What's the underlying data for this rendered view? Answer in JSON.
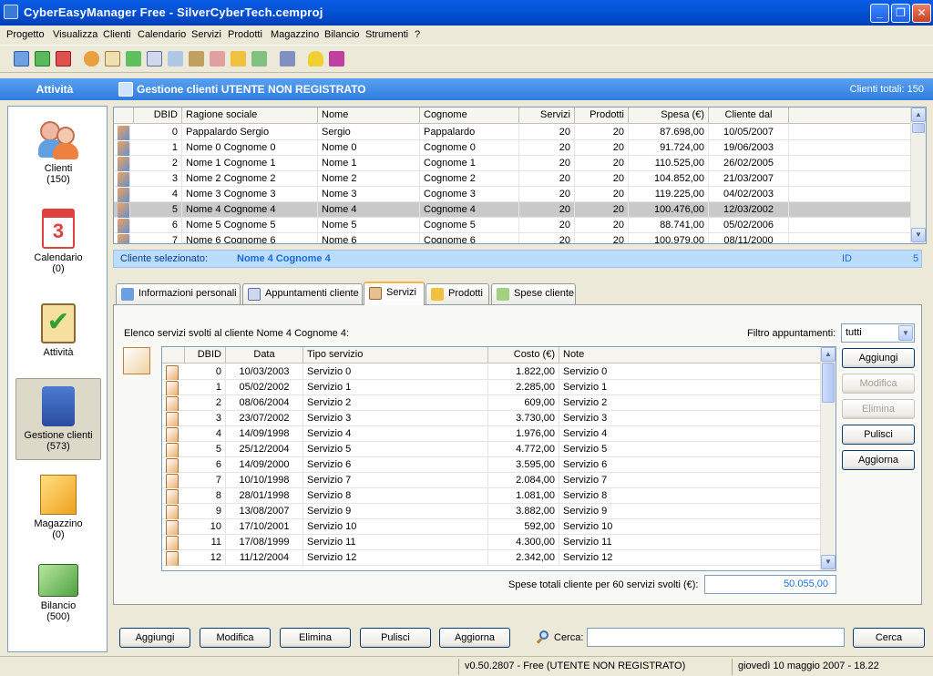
{
  "window": {
    "title": "CyberEasyManager Free - SilverCyberTech.cemproj"
  },
  "menu": [
    "Progetto",
    "Visualizza",
    "Clienti",
    "Calendario",
    "Servizi",
    "Prodotti",
    "Magazzino",
    "Bilancio",
    "Strumenti",
    "?"
  ],
  "header": {
    "section": "Attività",
    "title": "Gestione clienti UTENTE NON REGISTRATO",
    "count_label": "Clienti totali: 150"
  },
  "nav": [
    {
      "label": "Clienti",
      "count": "(150)"
    },
    {
      "label": "Calendario",
      "count": "(0)"
    },
    {
      "label": "Attività",
      "count": ""
    },
    {
      "label": "Gestione clienti",
      "count": "(573)"
    },
    {
      "label": "Magazzino",
      "count": "(0)"
    },
    {
      "label": "Bilancio",
      "count": "(500)"
    }
  ],
  "clients": {
    "columns": [
      "DBID",
      "Ragione sociale",
      "Nome",
      "Cognome",
      "Servizi",
      "Prodotti",
      "Spesa (€)",
      "Cliente dal"
    ],
    "rows": [
      [
        "0",
        "Pappalardo Sergio",
        "Sergio",
        "Pappalardo",
        "20",
        "20",
        "87.698,00",
        "10/05/2007"
      ],
      [
        "1",
        "Nome 0 Cognome 0",
        "Nome 0",
        "Cognome 0",
        "20",
        "20",
        "91.724,00",
        "19/06/2003"
      ],
      [
        "2",
        "Nome 1 Cognome 1",
        "Nome 1",
        "Cognome 1",
        "20",
        "20",
        "110.525,00",
        "26/02/2005"
      ],
      [
        "3",
        "Nome 2 Cognome 2",
        "Nome 2",
        "Cognome 2",
        "20",
        "20",
        "104.852,00",
        "21/03/2007"
      ],
      [
        "4",
        "Nome 3 Cognome 3",
        "Nome 3",
        "Cognome 3",
        "20",
        "20",
        "119.225,00",
        "04/02/2003"
      ],
      [
        "5",
        "Nome 4 Cognome 4",
        "Nome 4",
        "Cognome 4",
        "20",
        "20",
        "100.476,00",
        "12/03/2002"
      ],
      [
        "6",
        "Nome 5 Cognome 5",
        "Nome 5",
        "Cognome 5",
        "20",
        "20",
        "88.741,00",
        "05/02/2006"
      ],
      [
        "7",
        "Nome 6 Cognome 6",
        "Nome 6",
        "Cognome 6",
        "20",
        "20",
        "100.979,00",
        "08/11/2000"
      ]
    ],
    "selected_index": 5
  },
  "selected_client": {
    "label": "Cliente selezionato:",
    "name": "Nome 4 Cognome 4",
    "id_label": "ID",
    "id_value": "5"
  },
  "tabs": [
    "Informazioni personali",
    "Appuntamenti cliente",
    "Servizi",
    "Prodotti",
    "Spese cliente"
  ],
  "active_tab": 2,
  "services": {
    "caption": "Elenco servizi svolti al cliente Nome 4 Cognome 4:",
    "filter_label": "Filtro appuntamenti:",
    "filter_value": "tutti",
    "columns": [
      "DBID",
      "Data",
      "Tipo servizio",
      "Costo (€)",
      "Note"
    ],
    "rows": [
      [
        "0",
        "10/03/2003",
        "Servizio  0",
        "1.822,00",
        "Servizio  0"
      ],
      [
        "1",
        "05/02/2002",
        "Servizio  1",
        "2.285,00",
        "Servizio  1"
      ],
      [
        "2",
        "08/06/2004",
        "Servizio  2",
        "609,00",
        "Servizio  2"
      ],
      [
        "3",
        "23/07/2002",
        "Servizio  3",
        "3.730,00",
        "Servizio  3"
      ],
      [
        "4",
        "14/09/1998",
        "Servizio  4",
        "1.976,00",
        "Servizio  4"
      ],
      [
        "5",
        "25/12/2004",
        "Servizio  5",
        "4.772,00",
        "Servizio  5"
      ],
      [
        "6",
        "14/09/2000",
        "Servizio  6",
        "3.595,00",
        "Servizio  6"
      ],
      [
        "7",
        "10/10/1998",
        "Servizio  7",
        "2.084,00",
        "Servizio  7"
      ],
      [
        "8",
        "28/01/1998",
        "Servizio  8",
        "1.081,00",
        "Servizio  8"
      ],
      [
        "9",
        "13/08/2007",
        "Servizio  9",
        "3.882,00",
        "Servizio  9"
      ],
      [
        "10",
        "17/10/2001",
        "Servizio  10",
        "592,00",
        "Servizio  10"
      ],
      [
        "11",
        "17/08/1999",
        "Servizio  11",
        "4.300,00",
        "Servizio  11"
      ],
      [
        "12",
        "11/12/2004",
        "Servizio  12",
        "2.342,00",
        "Servizio  12"
      ]
    ],
    "buttons": [
      "Aggiungi",
      "Modifica",
      "Elimina",
      "Pulisci",
      "Aggiorna"
    ],
    "total_label": "Spese totali cliente per 60 servizi svolti (€):",
    "total_value": "50.055,00"
  },
  "bottom": {
    "buttons": [
      "Aggiungi",
      "Modifica",
      "Elimina",
      "Pulisci",
      "Aggiorna"
    ],
    "search_label": "Cerca:",
    "search_value": "",
    "search_button": "Cerca"
  },
  "status": {
    "version": "v0.50.2807 - Free (UTENTE NON REGISTRATO)",
    "datetime": "giovedì 10 maggio 2007 - 18.22"
  },
  "colors": {
    "accent": "#2f7de0",
    "selected_bar": "#bcdcfb",
    "total_value": "#1f6fd6"
  }
}
